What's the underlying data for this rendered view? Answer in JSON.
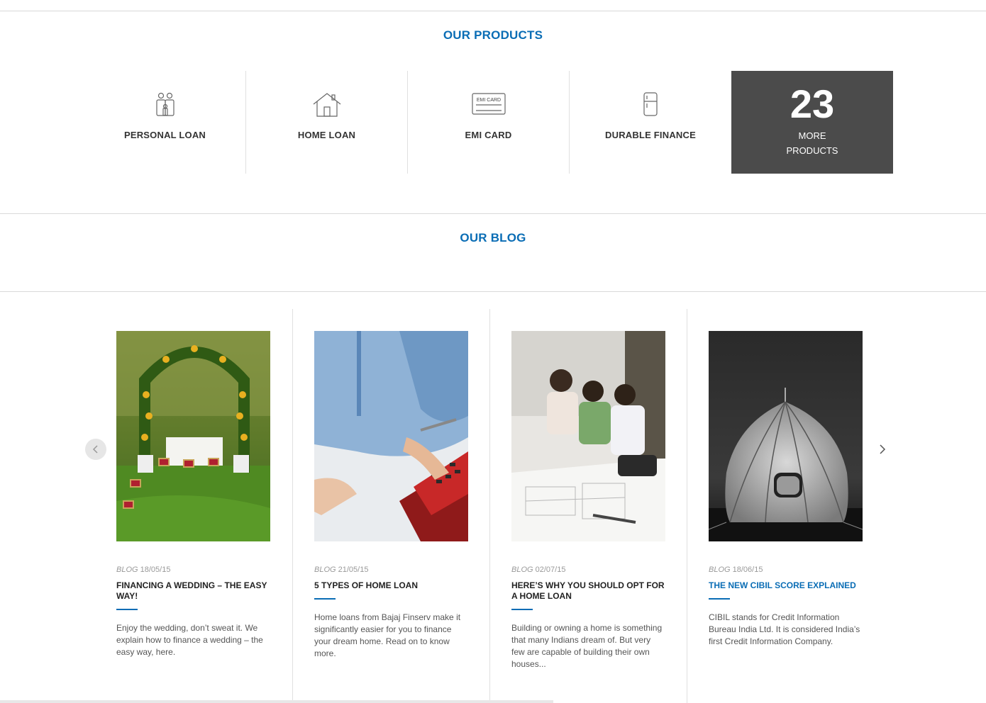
{
  "products_section": {
    "title": "OUR PRODUCTS",
    "items": [
      {
        "label": "PERSONAL LOAN",
        "icon": "people-icon"
      },
      {
        "label": "HOME LOAN",
        "icon": "house-icon"
      },
      {
        "label": "EMI CARD",
        "icon": "emi-card-icon",
        "icon_text": "EMI CARD"
      },
      {
        "label": "DURABLE FINANCE",
        "icon": "refrigerator-icon"
      }
    ],
    "more": {
      "count": "23",
      "line1": "MORE",
      "line2": "PRODUCTS"
    }
  },
  "blog_section": {
    "title": "OUR BLOG",
    "posts": [
      {
        "category": "BLOG",
        "date": "18/05/15",
        "title": "FINANCING A WEDDING – THE EASY WAY!",
        "description": "Enjoy the wedding, don’t sweat it. We explain how to finance a wedding – the easy way, here.",
        "image": "wedding-arch-photo"
      },
      {
        "category": "BLOG",
        "date": "21/05/15",
        "title": "5 TYPES OF HOME LOAN",
        "description": "Home loans from Bajaj Finserv make it significantly easier for you to finance your dream home. Read on to know more.",
        "image": "calculator-photo"
      },
      {
        "category": "BLOG",
        "date": "02/07/15",
        "title": "HERE’S WHY YOU SHOULD OPT FOR A HOME LOAN",
        "description": "Building or owning a home is something that many Indians dream of. But very few are capable of building their own houses...",
        "image": "family-blueprint-photo"
      },
      {
        "category": "BLOG",
        "date": "18/06/15",
        "title": "THE NEW CIBIL SCORE EXPLAINED",
        "description": "CIBIL stands for Credit Information Bureau India Ltd. It is considered India’s first Credit Information Company.",
        "image": "tent-night-photo",
        "highlighted": true
      }
    ]
  },
  "colors": {
    "accent": "#0a6db5",
    "more_bg": "#4b4b4b",
    "divider": "#d9d9d9"
  }
}
